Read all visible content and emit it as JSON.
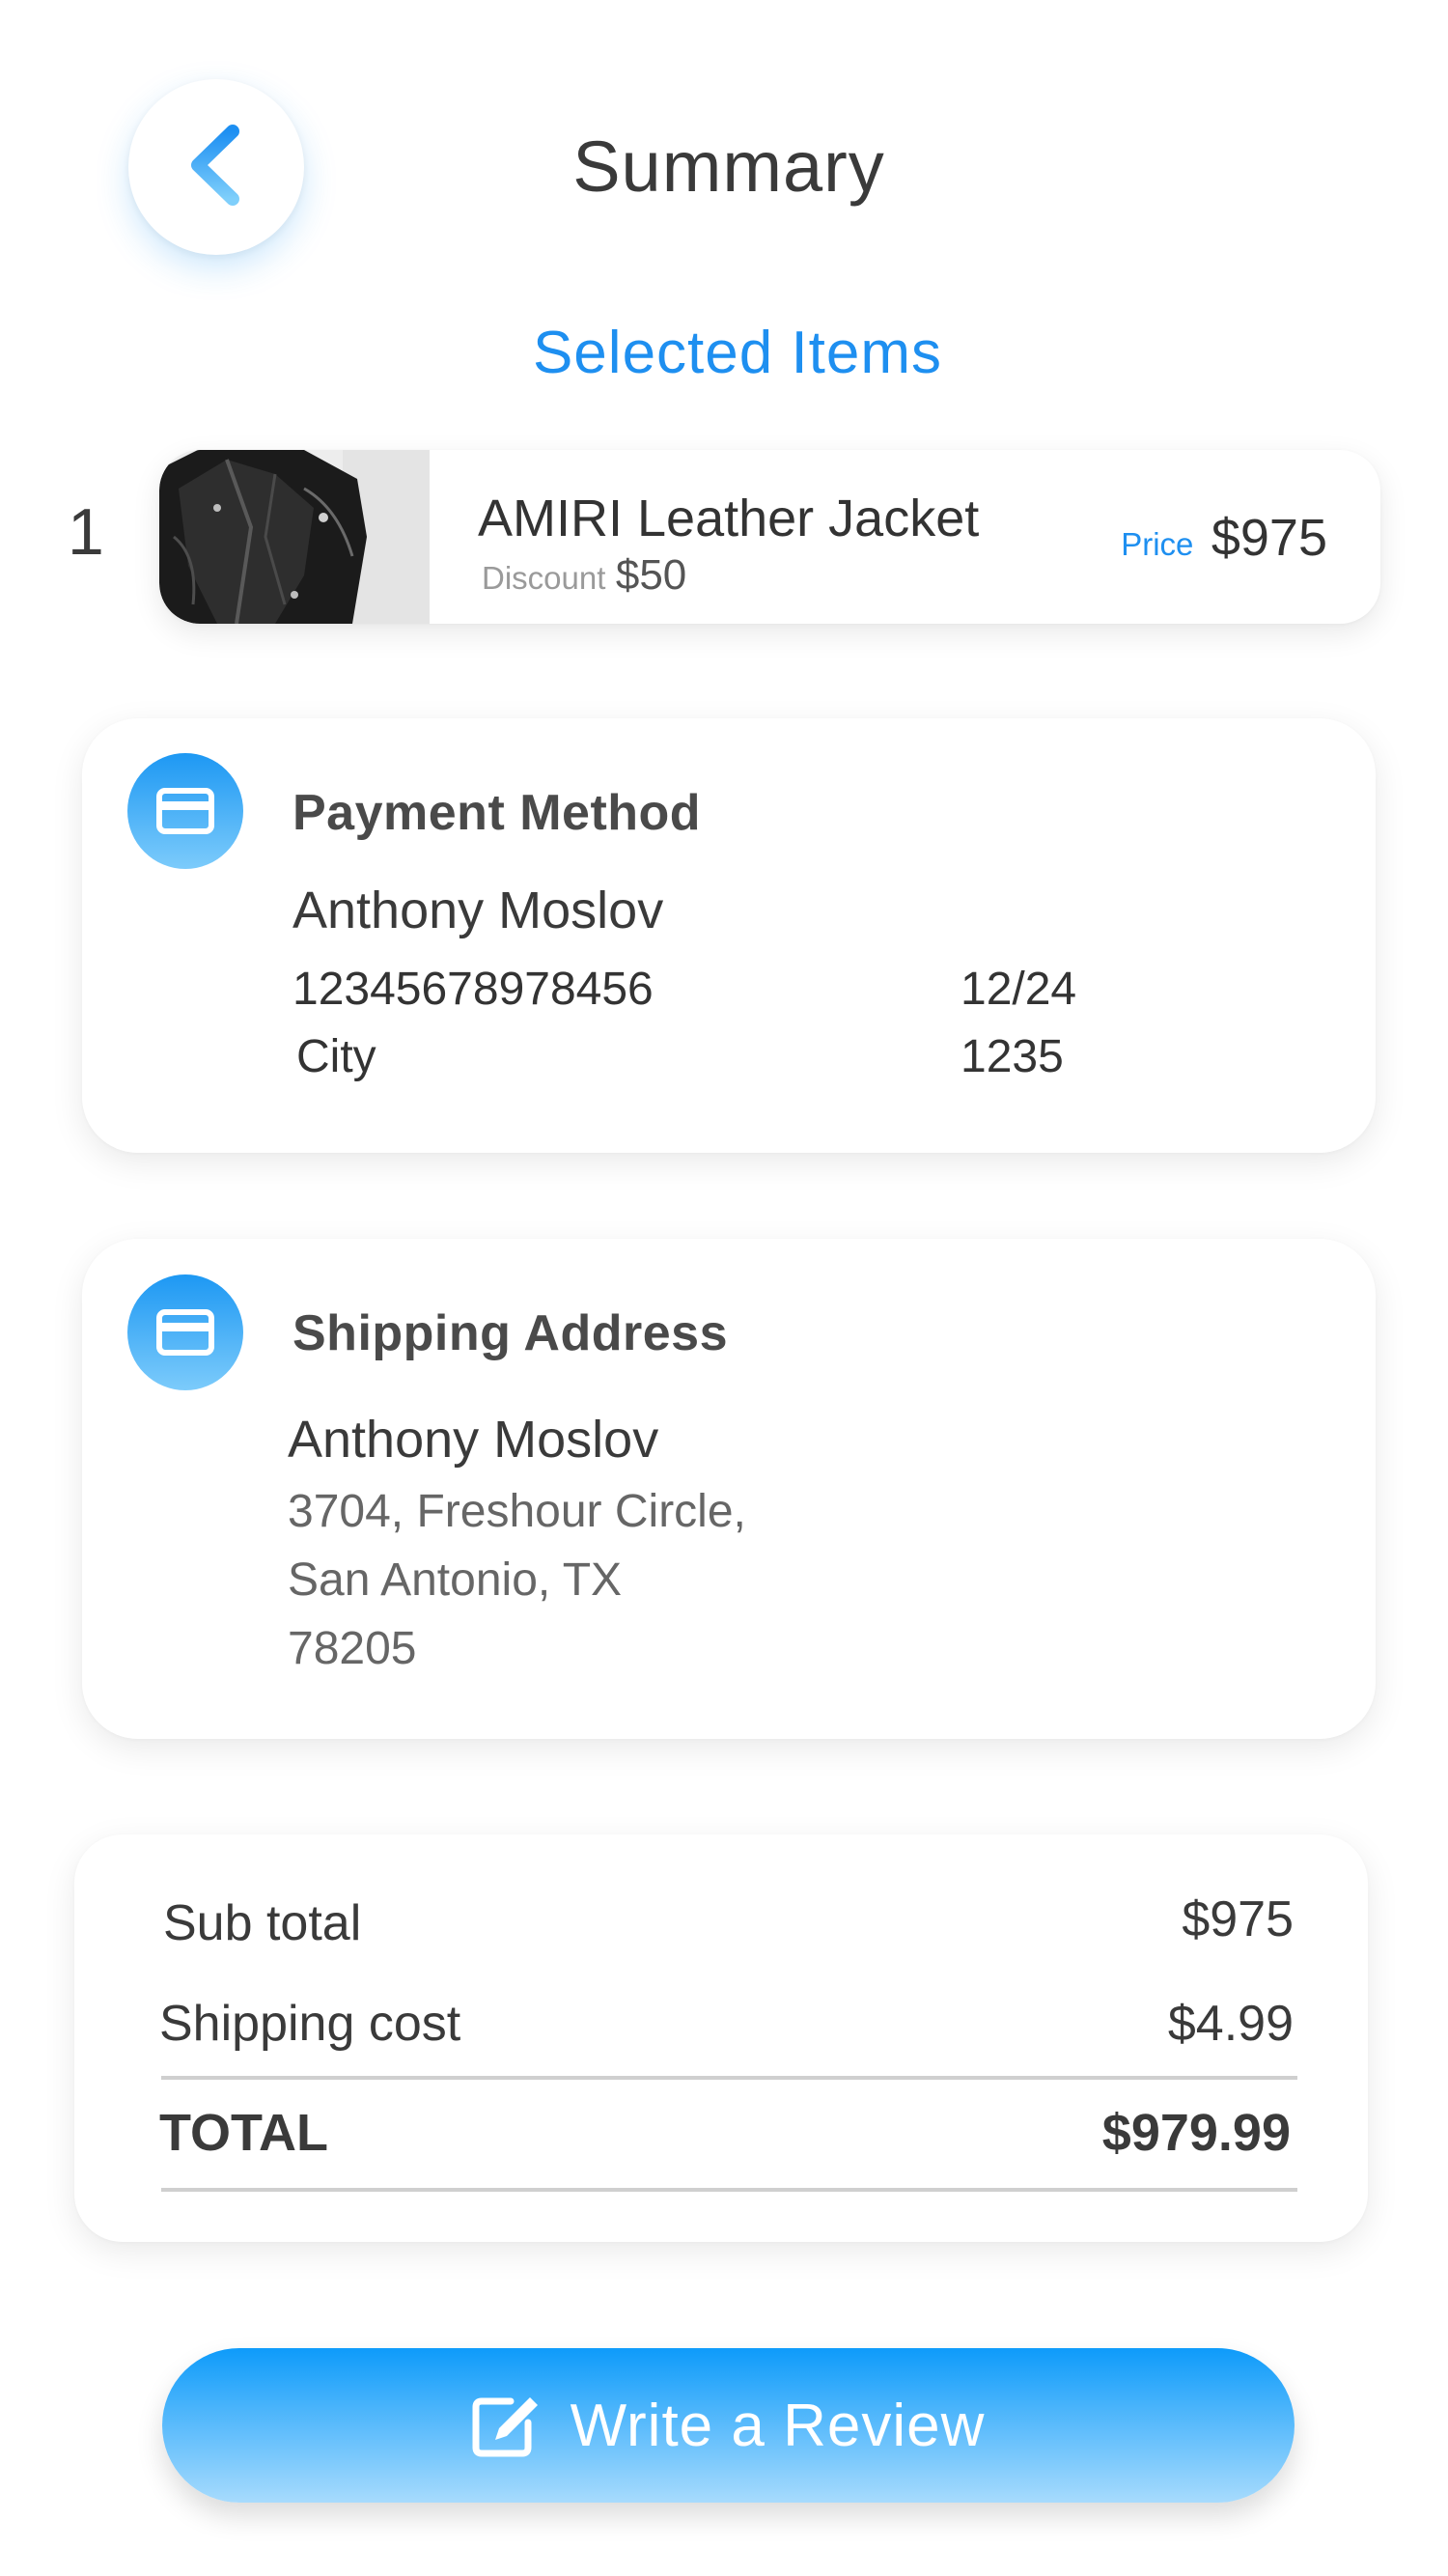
{
  "header": {
    "title": "Summary",
    "back_icon": "chevron-left-icon"
  },
  "selected_items_heading": "Selected Items",
  "items": [
    {
      "index": "1",
      "name": "AMIRI Leather Jacket",
      "discount_label": "Discount",
      "discount_value": "$50",
      "price_label": "Price",
      "price_value": "$975",
      "thumbnail": "leather-jacket-photo"
    }
  ],
  "payment": {
    "heading": "Payment Method",
    "icon": "credit-card-icon",
    "cardholder": "Anthony Moslov",
    "card_number": "12345678978456",
    "expiry": "12/24",
    "city": "City",
    "code": "1235"
  },
  "shipping": {
    "heading": "Shipping Address",
    "icon": "credit-card-icon",
    "name": "Anthony Moslov",
    "address_line1": "3704, Freshour Circle,",
    "address_line2": "San Antonio, TX",
    "zip": "78205"
  },
  "totals": {
    "subtotal_label": "Sub total",
    "subtotal_value": "$975",
    "shipping_label": "Shipping cost",
    "shipping_value": "$4.99",
    "total_label": "TOTAL",
    "total_value": "$979.99"
  },
  "cta": {
    "label": "Write a Review",
    "icon": "edit-icon"
  },
  "colors": {
    "accent": "#1e8ff0",
    "button_gradient_top": "#0e9bfa",
    "button_gradient_bottom": "#a7dbfd",
    "text_dark": "#3a3a3a"
  }
}
